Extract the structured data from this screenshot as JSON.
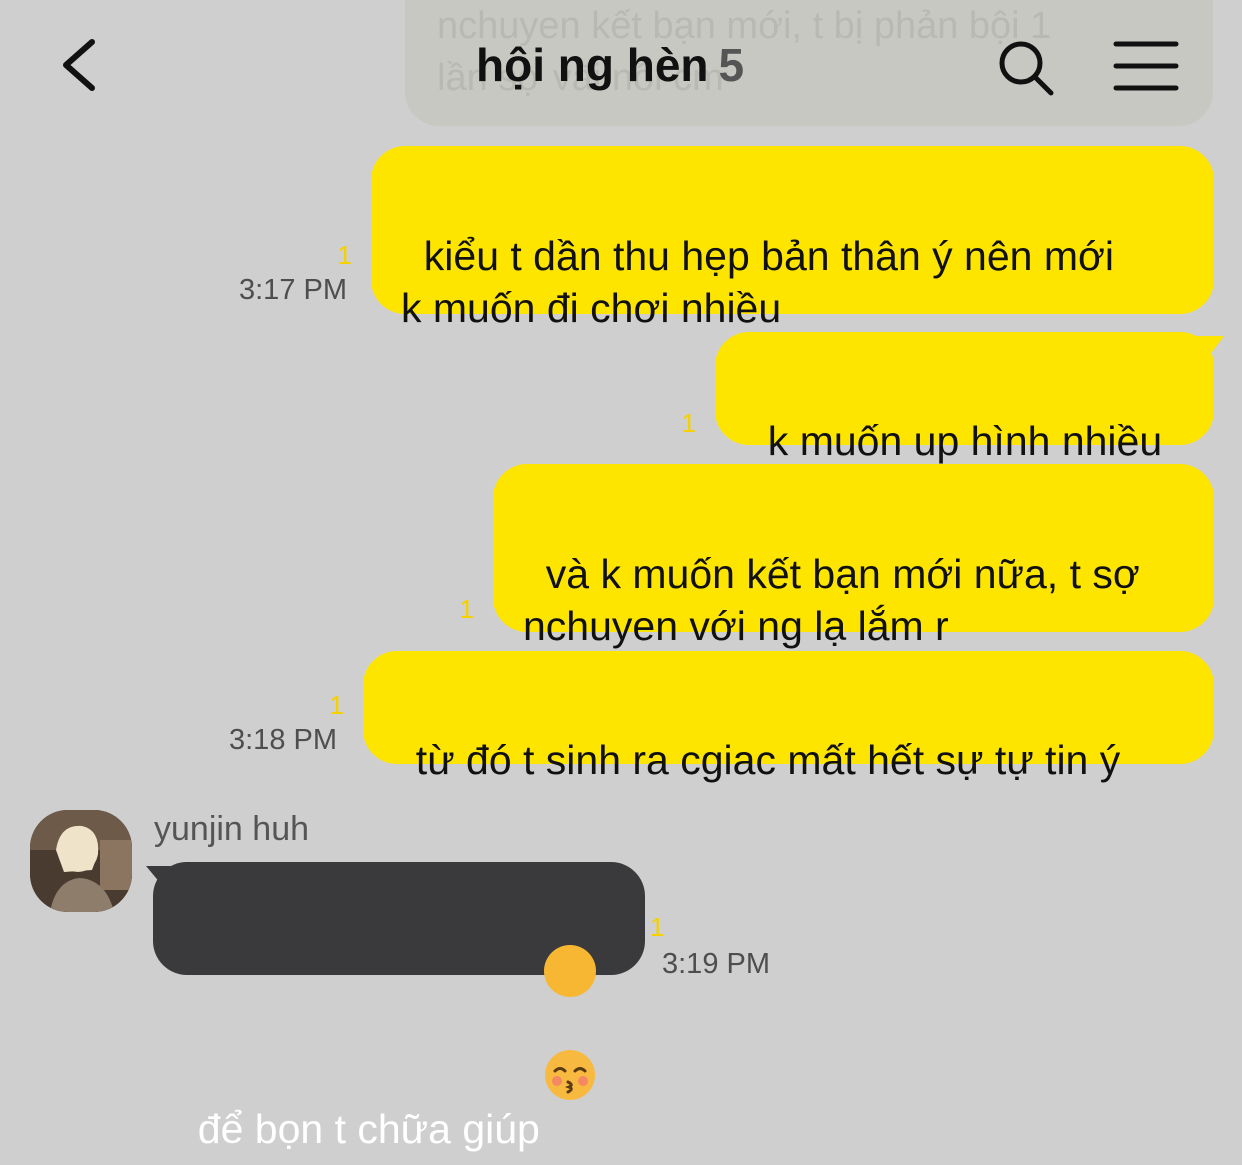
{
  "header": {
    "title": "hội ng hèn",
    "member_count": "5"
  },
  "ghost_message": "nchuyen kết bạn mới, t bị phản bội 1\nlần sợ vãi nồi cm",
  "messages": [
    {
      "text": "kiểu t dần thu hẹp bản thân ý nên mới\nk muốn đi chơi nhiều",
      "unread": "1",
      "time": "3:17 PM"
    },
    {
      "text": "k muốn up hình nhiều",
      "unread": "1",
      "time": ""
    },
    {
      "text": "và k muốn kết bạn mới nữa, t sợ\nnchuyen với ng lạ lắm r",
      "unread": "1",
      "time": ""
    },
    {
      "text": "từ đó t sinh ra cgiac mất hết sự tự tin ý",
      "unread": "1",
      "time": "3:18 PM"
    }
  ],
  "incoming": {
    "sender": "yunjin huh",
    "text": "để bọn t chữa giúp",
    "emoji": "kissing-face-with-closed-eyes",
    "unread": "1",
    "time": "3:19 PM"
  },
  "colors": {
    "background": "#cfcfcf",
    "my_bubble": "#fee500",
    "their_bubble": "#3a3a3c",
    "unread": "#f6d000"
  },
  "icons": {
    "back": "chevron-left-icon",
    "search": "search-icon",
    "menu": "hamburger-menu-icon"
  }
}
